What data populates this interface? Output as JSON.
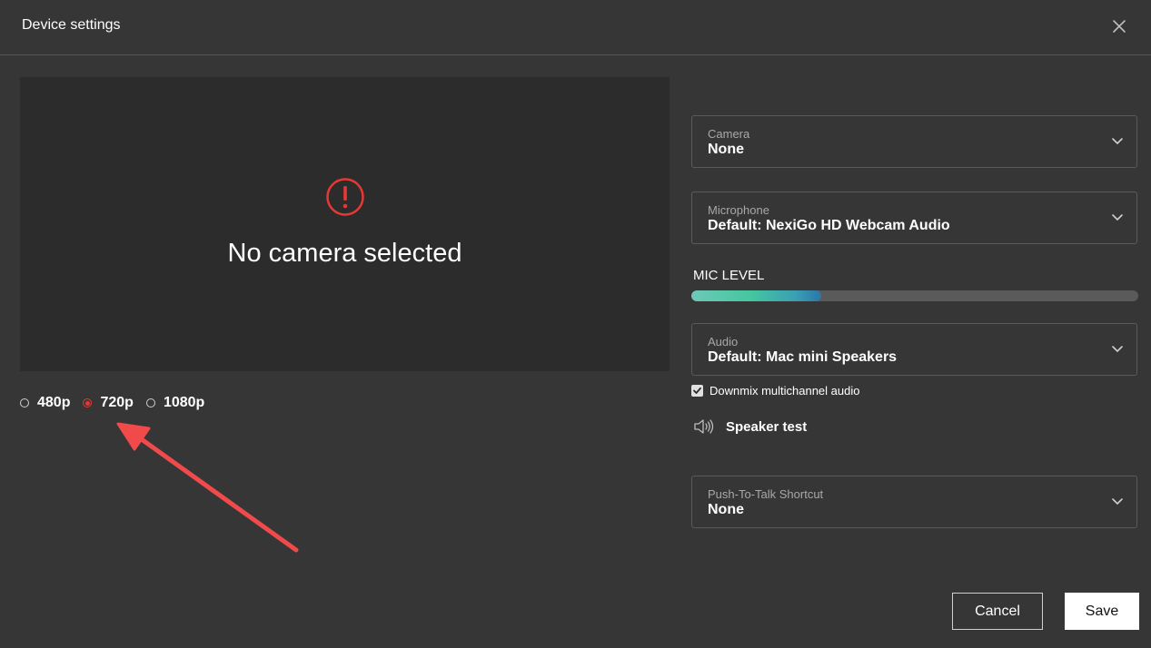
{
  "dialog": {
    "title": "Device settings",
    "close_icon": "close-icon"
  },
  "preview": {
    "warning_icon": "exclamation-circle-icon",
    "message": "No camera selected"
  },
  "resolution": {
    "options": [
      {
        "label": "480p",
        "selected": false
      },
      {
        "label": "720p",
        "selected": true
      },
      {
        "label": "1080p",
        "selected": false
      }
    ]
  },
  "camera": {
    "label": "Camera",
    "value": "None"
  },
  "microphone": {
    "label": "Microphone",
    "value": "Default: NexiGo HD Webcam Audio"
  },
  "mic_level": {
    "label": "MIC LEVEL",
    "level_fraction": 0.29
  },
  "audio": {
    "label": "Audio",
    "value": "Default: Mac mini Speakers"
  },
  "downmix": {
    "label": "Downmix multichannel audio",
    "checked": true
  },
  "speaker_test": {
    "label": "Speaker test",
    "icon": "speaker-icon"
  },
  "push_to_talk": {
    "label": "Push-To-Talk Shortcut",
    "value": "None"
  },
  "buttons": {
    "cancel": "Cancel",
    "save": "Save"
  },
  "colors": {
    "background": "#363636",
    "preview_background": "#2c2c2c",
    "accent_red": "#e53935",
    "annotation_arrow": "#f04a4a"
  }
}
